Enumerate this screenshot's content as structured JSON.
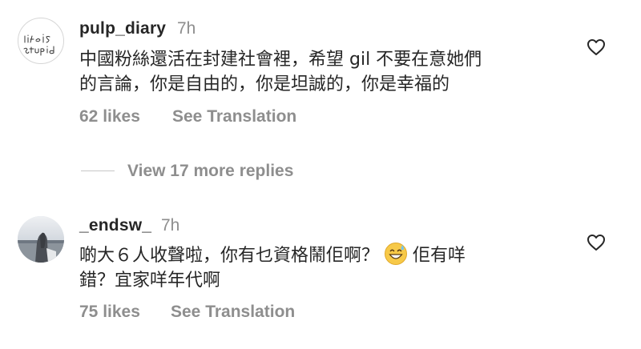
{
  "comments": [
    {
      "username": "pulp_diary",
      "time": "7h",
      "text_line1": "中國粉絲還活在封建社會裡，希望 gil 不要在意她們",
      "text_line2": "的言論，你是自由的，你是坦誠的，你是幸福的",
      "likes": "62 likes",
      "translate": "See Translation",
      "avatar_text": "life is stupid",
      "icons": {
        "like": "heart-outline-icon"
      }
    },
    {
      "username": "_endsw_",
      "time": "7h",
      "text_line1_before_emoji": "啲大６人收聲啦，你有乜資格鬧佢啊？",
      "emoji": "grinning-sweat-emoji",
      "text_line1_after_emoji": "佢有咩",
      "text_line2": "錯？宜家咩年代啊",
      "likes": "75 likes",
      "translate": "See Translation",
      "icons": {
        "like": "heart-outline-icon"
      }
    }
  ],
  "view_replies": "View 17 more replies"
}
